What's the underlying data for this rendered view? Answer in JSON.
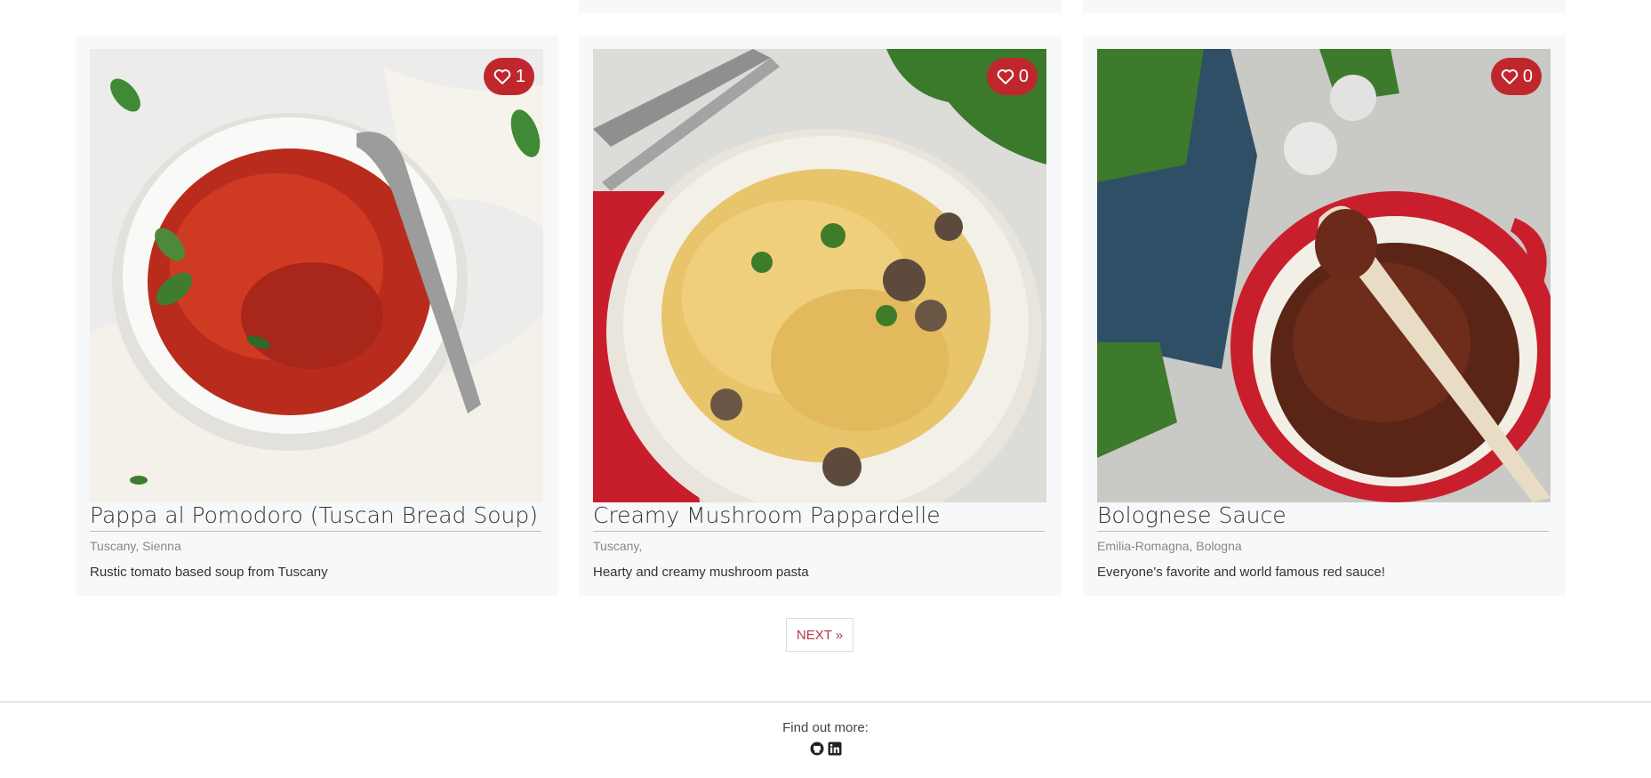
{
  "cards": [
    {
      "title": "Pappa al Pomodoro (Tuscan Bread Soup)",
      "location": "Tuscany, Sienna",
      "description": "Rustic tomato based soup from Tuscany",
      "likes": "1",
      "image_icon": "tomato-soup-photo"
    },
    {
      "title": "Creamy Mushroom Pappardelle",
      "location": "Tuscany,",
      "description": "Hearty and creamy mushroom pasta",
      "likes": "0",
      "image_icon": "mushroom-pasta-photo"
    },
    {
      "title": "Bolognese Sauce",
      "location": "Emilia-Romagna, Bologna",
      "description": "Everyone's favorite and world famous red sauce!",
      "likes": "0",
      "image_icon": "bolognese-photo"
    }
  ],
  "pagination": {
    "next_label": "NEXT »"
  },
  "footer": {
    "find_label": "Find out more:",
    "icons": [
      "github-icon",
      "linkedin-icon"
    ]
  },
  "colors": {
    "like_badge": "#c0272d",
    "next_text": "#b1384e",
    "card_bg": "#f7f8fa"
  }
}
